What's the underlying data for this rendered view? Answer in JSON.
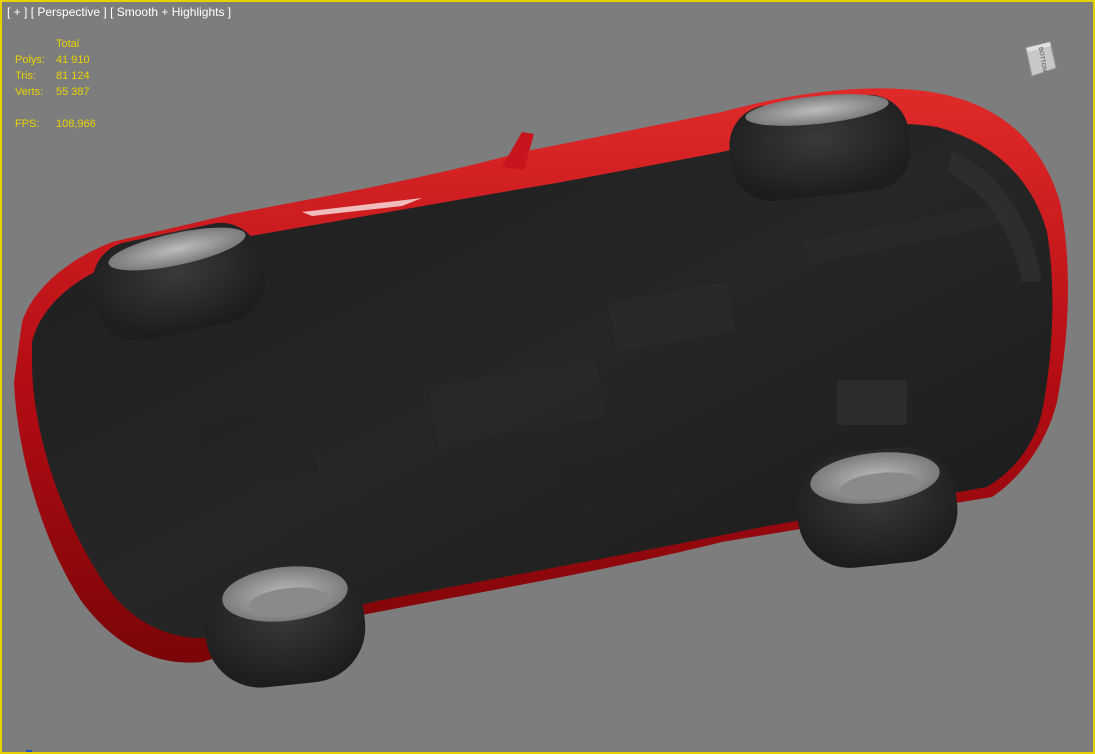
{
  "viewport": {
    "label_plus": "[ + ]",
    "label_view": "[ Perspective ]",
    "label_shading": "[ Smooth + Highlights ]",
    "border_color": "#e6d200",
    "background_color": "#7d7d7d"
  },
  "stats": {
    "header": "Total",
    "polys_label": "Polys:",
    "polys_value": "41 910",
    "tris_label": "Tris:",
    "tris_value": "81 124",
    "verts_label": "Verts:",
    "verts_value": "55 387",
    "fps_label": "FPS:",
    "fps_value": "108,966",
    "text_color": "#e8d200"
  },
  "viewcube": {
    "face_label": "BOTTOM",
    "icon": "viewcube-icon"
  },
  "model": {
    "body_color": "#c2121a",
    "underbody_color": "#1c1c1c",
    "tire_color": "#262626",
    "rim_color": "#9a9a9a"
  }
}
